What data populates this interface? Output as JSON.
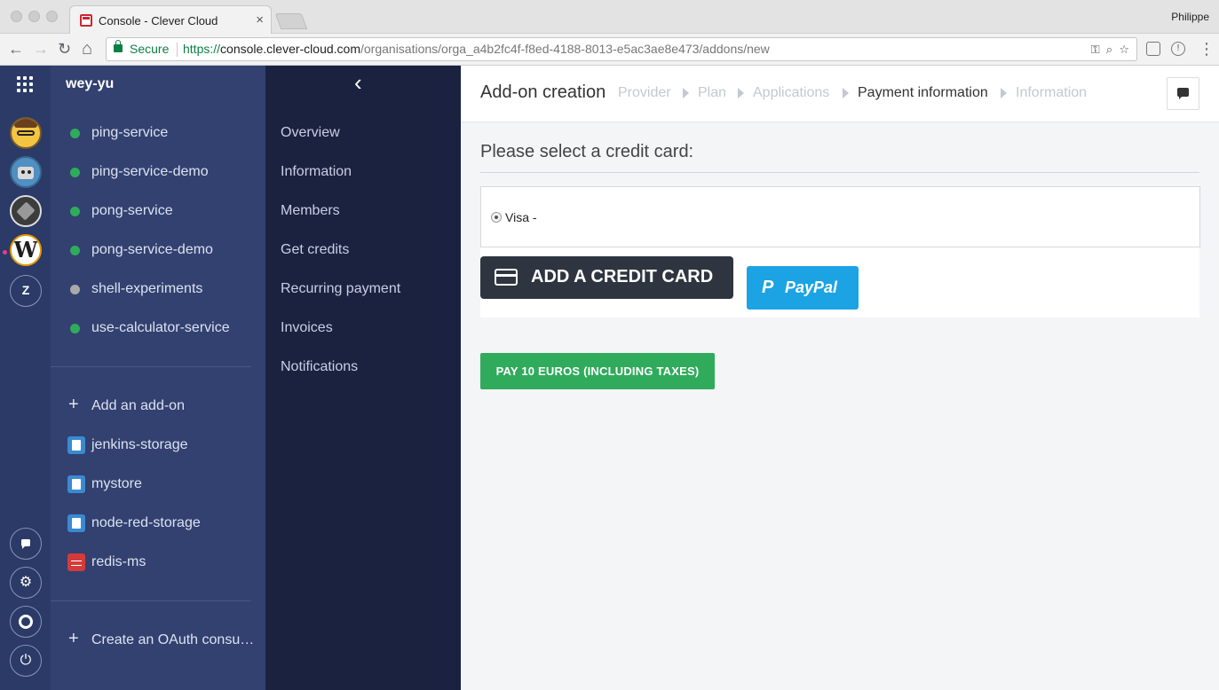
{
  "browser": {
    "tab_title": "Console - Clever Cloud",
    "tab_close": "×",
    "profile_name": "Philippe",
    "secure_label": "Secure",
    "url_scheme": "https://",
    "url_host": "console.clever-cloud.com",
    "url_path": "/organisations/orga_a4b2fc4f-f8ed-4188-8013-e5ac3ae8e473/addons/new",
    "back_glyph": "←",
    "forward_glyph": "→",
    "reload_glyph": "↻",
    "home_glyph": "⌂",
    "menu_glyph": "⋮"
  },
  "rail": {
    "orgs": [
      {
        "name": "avatar-glasses",
        "label": ""
      },
      {
        "name": "avatar-robot",
        "label": ""
      },
      {
        "name": "avatar-dark",
        "label": ""
      },
      {
        "name": "avatar-w",
        "label": "W"
      },
      {
        "name": "avatar-z",
        "label": "Z"
      }
    ],
    "bottom_icons": [
      "chat-icon",
      "gear-icon",
      "lifebuoy-icon",
      "power-icon"
    ],
    "active_color": "#e83e8c"
  },
  "apps_panel": {
    "org_name": "wey-yu",
    "applications": [
      {
        "label": "ping-service",
        "status_color": "#2fab5b"
      },
      {
        "label": "ping-service-demo",
        "status_color": "#2fab5b"
      },
      {
        "label": "pong-service",
        "status_color": "#2fab5b"
      },
      {
        "label": "pong-service-demo",
        "status_color": "#2fab5b"
      },
      {
        "label": "shell-experiments",
        "status_color": "#a9a9a9"
      },
      {
        "label": "use-calculator-service",
        "status_color": "#2fab5b"
      }
    ],
    "add_addon_label": "Add an add-on",
    "addons": [
      {
        "label": "jenkins-storage",
        "icon": "fs-bucket-icon"
      },
      {
        "label": "mystore",
        "icon": "fs-bucket-icon"
      },
      {
        "label": "node-red-storage",
        "icon": "fs-bucket-icon"
      },
      {
        "label": "redis-ms",
        "icon": "redis-icon"
      }
    ],
    "create_oauth_label": "Create an OAuth consu…"
  },
  "org_menu": {
    "collapse_glyph": "‹",
    "items": [
      "Overview",
      "Information",
      "Members",
      "Get credits",
      "Recurring payment",
      "Invoices",
      "Notifications"
    ]
  },
  "main": {
    "title": "Add-on creation",
    "steps": [
      {
        "label": "Provider",
        "active": false
      },
      {
        "label": "Plan",
        "active": false
      },
      {
        "label": "Applications",
        "active": false
      },
      {
        "label": "Payment information",
        "active": true
      },
      {
        "label": "Information",
        "active": false
      }
    ],
    "select_card_title": "Please select a credit card:",
    "card_option_label": "Visa -",
    "add_card_label": "ADD A CREDIT CARD",
    "paypal_label": "PayPal",
    "pay_button_label": "PAY 10 EUROS (INCLUDING TAXES)",
    "colors": {
      "pay_green": "#2fab5b",
      "paypal_blue": "#1ca3e3",
      "sidebar": "#324170"
    }
  }
}
